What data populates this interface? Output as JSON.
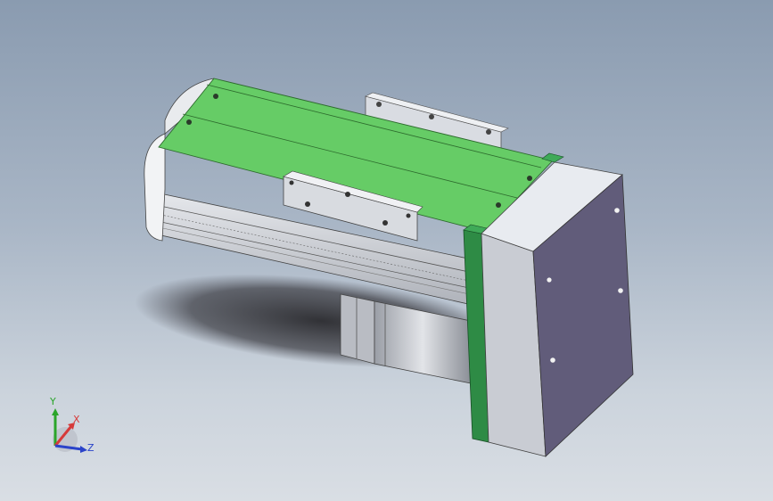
{
  "viewport": {
    "background_top": "#8a9bb0",
    "background_bottom": "#d9dee4"
  },
  "model": {
    "rail_color": "#66cc66",
    "endcap_color": "#2e8b45",
    "housing_color": "#d7dbe1",
    "motor_plate_color": "#615c7a",
    "carriage_color": "#c9ccd3"
  },
  "triad": {
    "x_label": "X",
    "y_label": "Y",
    "z_label": "Z",
    "x_color": "#d63a3a",
    "y_color": "#2aa52a",
    "z_color": "#2a43c9"
  }
}
